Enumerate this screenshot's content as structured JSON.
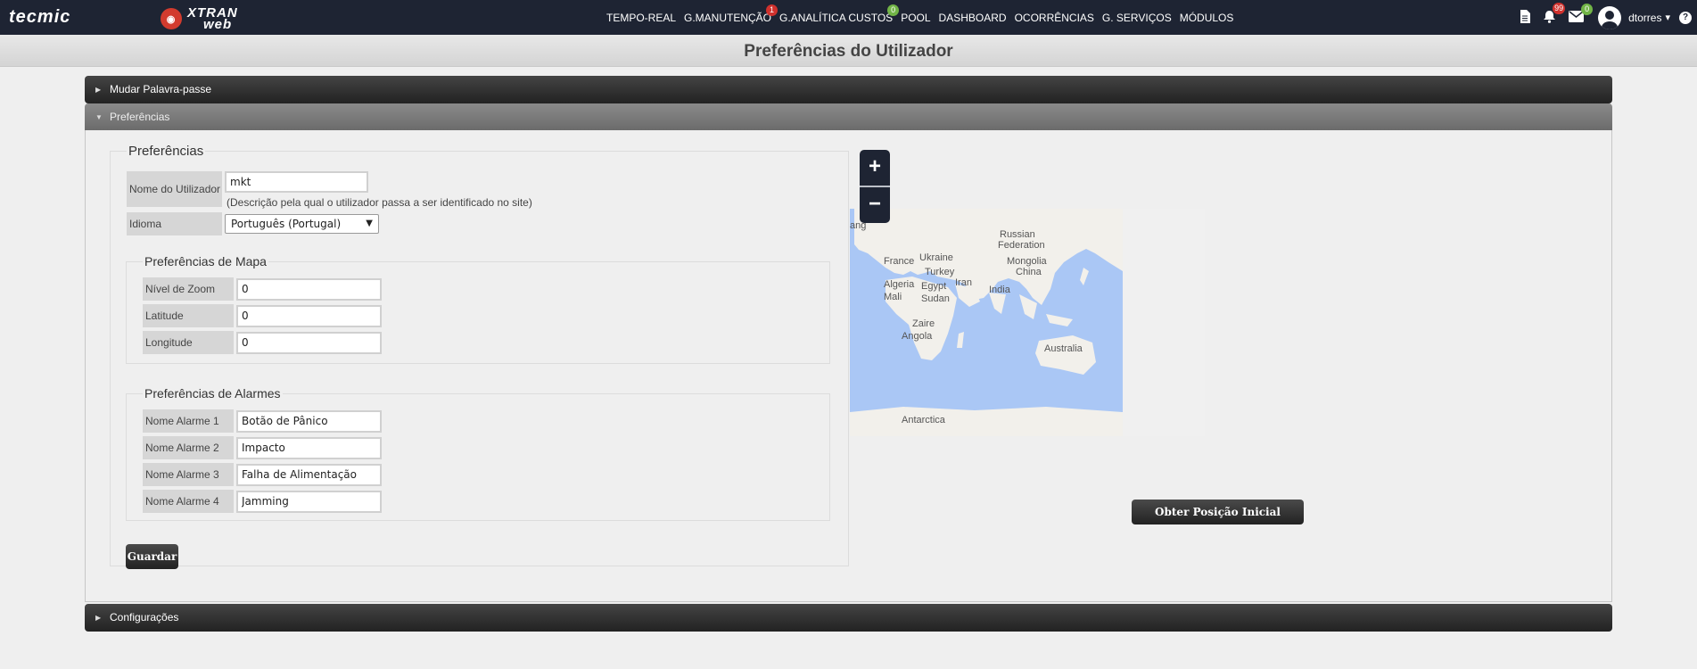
{
  "topbar": {
    "brand_left": "tecmic",
    "brand_right_line1": "XTRAN",
    "brand_right_line2": "web",
    "nav": [
      {
        "label": "TEMPO-REAL"
      },
      {
        "label": "G.MANUTENÇÃO",
        "badge": "1",
        "badge_color": "#d0312d"
      },
      {
        "label": "G.ANALÍTICA CUSTOS",
        "badge": "0",
        "badge_color": "#72b547"
      },
      {
        "label": "POOL"
      },
      {
        "label": "DASHBOARD"
      },
      {
        "label": "OCORRÊNCIAS"
      },
      {
        "label": "G. SERVIÇOS"
      },
      {
        "label": "MÓDULOS"
      }
    ],
    "icons": [
      {
        "name": "document-icon"
      },
      {
        "name": "bell-icon",
        "badge": "99",
        "badge_color": "#d0312d"
      },
      {
        "name": "mail-icon",
        "badge": "0",
        "badge_color": "#72b547"
      }
    ],
    "username": "dtorres",
    "help": "?"
  },
  "page_title": "Preferências do Utilizador",
  "accordion": {
    "change_password": "Mudar Palavra-passe",
    "preferences": "Preferências",
    "configurations": "Configurações"
  },
  "prefs": {
    "legend": "Preferências",
    "username_label": "Nome do Utilizador",
    "username_value": "mkt",
    "username_hint": "(Descrição pela qual o utilizador passa a ser identificado no site)",
    "language_label": "Idioma",
    "language_value": "Português (Portugal)",
    "map": {
      "legend": "Preferências de Mapa",
      "zoom_label": "Nível de Zoom",
      "zoom_value": "0",
      "lat_label": "Latitude",
      "lat_value": "0",
      "lon_label": "Longitude",
      "lon_value": "0"
    },
    "alarms": {
      "legend": "Preferências de Alarmes",
      "a1_label": "Nome Alarme 1",
      "a1_value": "Botão de Pânico",
      "a2_label": "Nome Alarme 2",
      "a2_value": "Impacto",
      "a3_label": "Nome Alarme 3",
      "a3_value": "Falha de Alimentação",
      "a4_label": "Nome Alarme 4",
      "a4_value": "Jamming"
    },
    "save_button": "Guardar"
  },
  "map_widget": {
    "labels": [
      "Russian",
      "Federation",
      "Ukraine",
      "France",
      "Mongolia",
      "Turkey",
      "China",
      "Iran",
      "Algeria",
      "Egypt",
      "India",
      "Mali",
      "Sudan",
      "Zaire",
      "Angola",
      "Australia",
      "Antarctica",
      "ang"
    ],
    "zoom_in": "+",
    "zoom_out": "−",
    "get_position_button": "Obter Posição Inicial"
  }
}
